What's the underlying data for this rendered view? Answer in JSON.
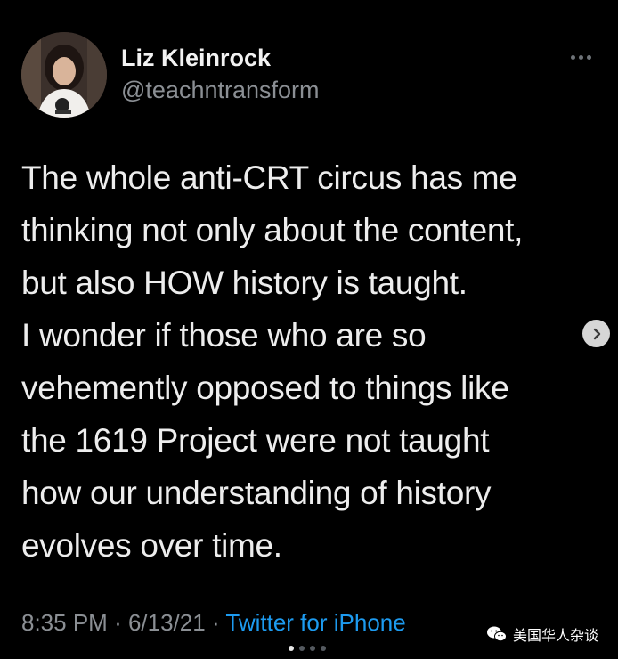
{
  "tweet": {
    "author_name": "Liz Kleinrock",
    "author_handle": "@teachntransform",
    "text_lines": [
      "The whole anti-CRT circus has me",
      "thinking not only about the content,",
      "but also HOW history is taught.",
      "I wonder if those who are so",
      "vehemently opposed to things like",
      "the 1619 Project were not taught",
      "how our understanding of history",
      "evolves over time."
    ],
    "time": "8:35 PM",
    "separator": "·",
    "date": "6/13/21",
    "source": "Twitter for iPhone"
  },
  "pagination": {
    "count": 4,
    "active_index": 0
  },
  "watermark": {
    "text": "美国华人杂谈"
  },
  "icons": {
    "more": "more-horizontal-icon",
    "next": "chevron-right-icon",
    "watermark": "wechat-icon"
  },
  "colors": {
    "background": "#000000",
    "text": "#ededed",
    "secondary": "#8b8f94",
    "link": "#1d9bf0"
  }
}
